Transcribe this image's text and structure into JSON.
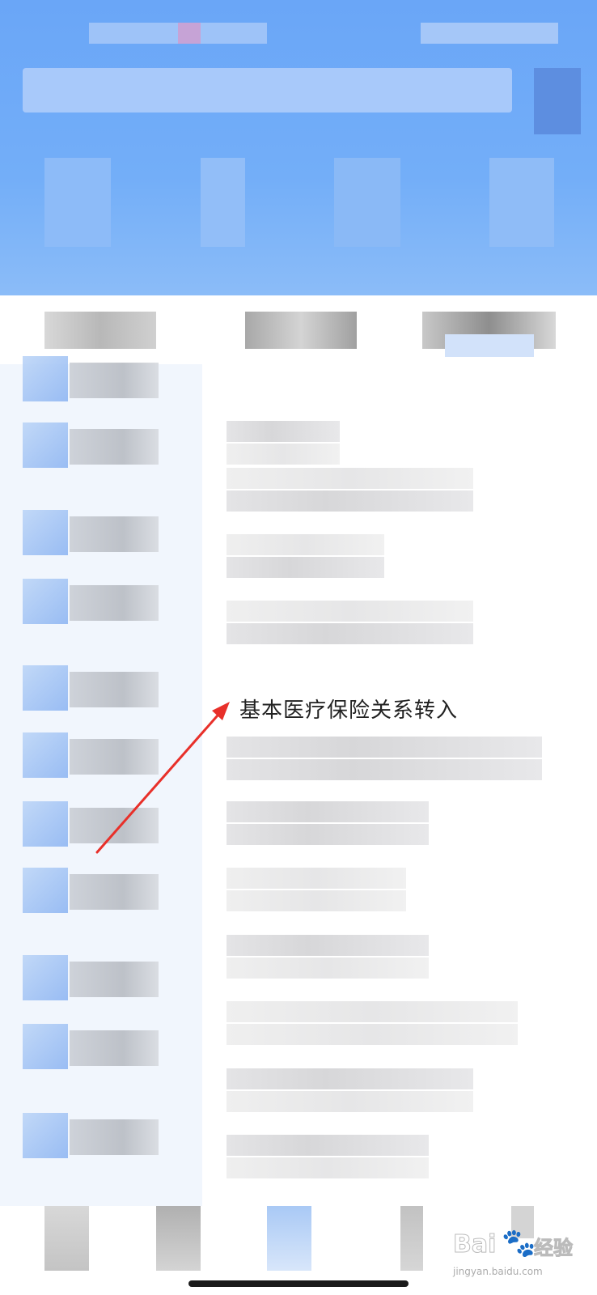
{
  "annotation": {
    "text": "基本医疗保险关系转入",
    "arrow_color": "#e8302a"
  },
  "watermark": {
    "brand": "Bai",
    "brand_suffix": "经验",
    "url": "jingyan.baidu.com"
  },
  "colors": {
    "header_blue": "#6aa6f7",
    "icon_blue": "#8fb6f2",
    "left_column_bg": "#f1f6fd",
    "blurred_text_gray": "#c8ccd3"
  }
}
